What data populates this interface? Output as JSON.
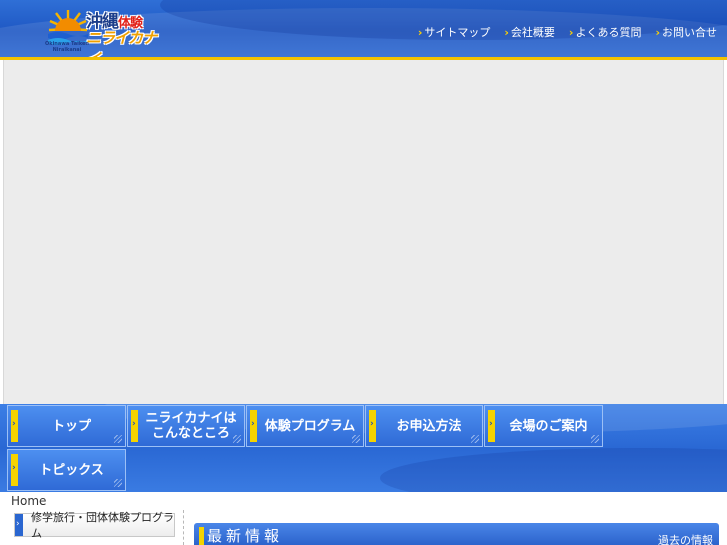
{
  "header": {
    "logo": {
      "main": "沖縄",
      "accent": "体験",
      "sub": "ニライカナイ",
      "tagline": "Okinawa Taiken Niraikanai"
    },
    "topnav": [
      "サイトマップ",
      "会社概要",
      "よくある質問",
      "お問い合せ"
    ]
  },
  "mainnav": {
    "row1": [
      "トップ",
      "ニライカナイは\nこんなところ",
      "体験プログラム",
      "お申込方法",
      "会場のご案内"
    ],
    "row2": [
      "トピックス"
    ]
  },
  "breadcrumb": "Home",
  "sidebar": {
    "button": "修学旅行・団体体験プログラム"
  },
  "news": {
    "title": "最新情報",
    "past_link": "過去の情報"
  },
  "colors": {
    "primary_blue": "#2a66d0",
    "accent_yellow": "#f5d300",
    "hero_gray": "#ececec"
  }
}
